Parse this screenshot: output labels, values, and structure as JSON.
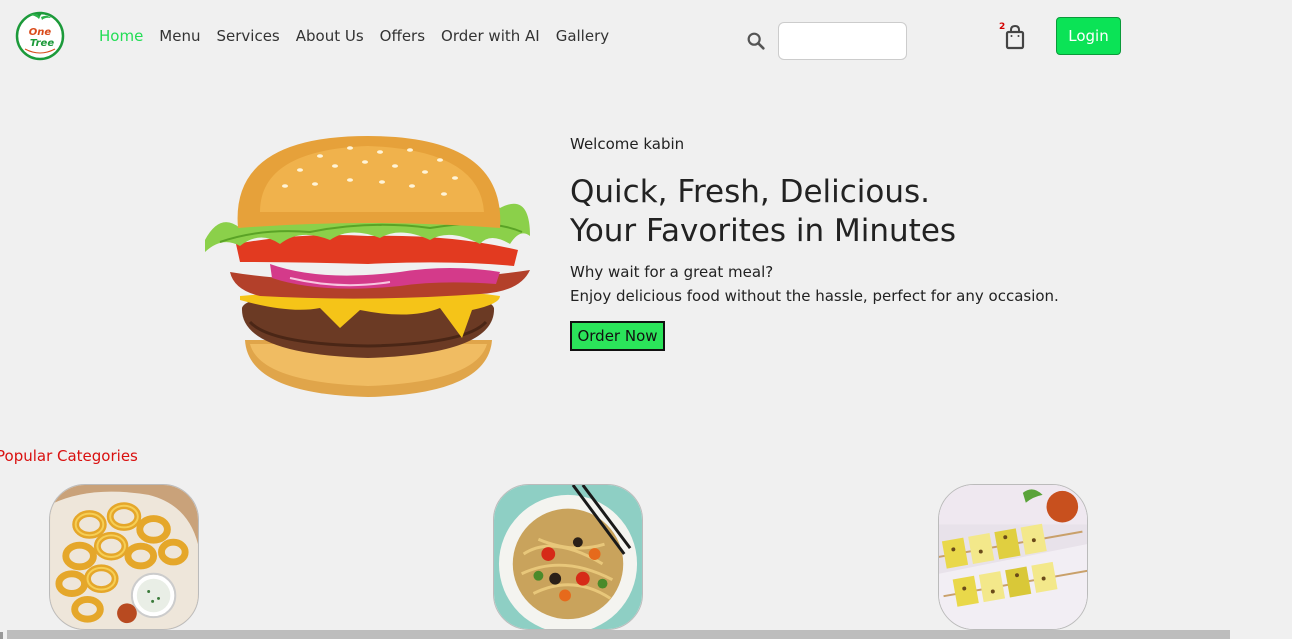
{
  "brand": {
    "logo_text_line1": "One",
    "logo_text_line2": "Tree"
  },
  "nav": {
    "items": [
      {
        "label": "Home",
        "active": true
      },
      {
        "label": "Menu",
        "active": false
      },
      {
        "label": "Services",
        "active": false
      },
      {
        "label": "About Us",
        "active": false
      },
      {
        "label": "Offers",
        "active": false
      },
      {
        "label": "Order with AI",
        "active": false
      },
      {
        "label": "Gallery",
        "active": false
      }
    ]
  },
  "search": {
    "value": "",
    "placeholder": "",
    "icon": "search-icon"
  },
  "cart": {
    "count": "2",
    "icon": "shopping-bag-icon"
  },
  "login": {
    "label": "Login"
  },
  "hero": {
    "welcome": "Welcome kabin",
    "headline_line1": "Quick, Fresh, Delicious.",
    "headline_line2": "Your Favorites in Minutes",
    "sub_line1": "Why wait for a great meal?",
    "sub_line2": "Enjoy delicious food without the hassle, perfect for any occasion.",
    "cta": "Order Now",
    "image": "burger"
  },
  "categories": {
    "title": "Popular Categories",
    "items": [
      {
        "image": "onion-rings"
      },
      {
        "image": "stir-fry-noodles"
      },
      {
        "image": "paneer-skewers"
      }
    ]
  },
  "colors": {
    "accent_green": "#2be45a",
    "active_nav": "#22dd55",
    "section_title_red": "#d9100f",
    "cart_badge": "#d40000",
    "background": "#f0f0f0"
  }
}
